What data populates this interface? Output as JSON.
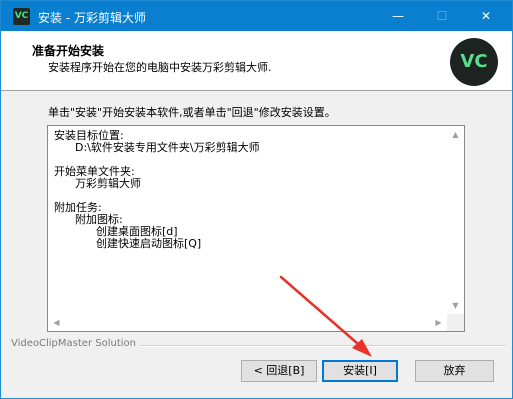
{
  "window": {
    "title": "安装 - 万彩剪辑大师",
    "app_icon_text": "VC",
    "controls": {
      "minimize": "—",
      "maximize": "☐",
      "close": "✕"
    }
  },
  "header": {
    "title": "准备开始安装",
    "subtitle": "安装程序开始在您的电脑中安装万彩剪辑大师.",
    "logo_text": "VC"
  },
  "instruction": "单击\"安装\"开始安装本软件,或者单击\"回退\"修改安装设置。",
  "summary": {
    "lines": [
      "安装目标位置:",
      "      D:\\软件安装专用文件夹\\万彩剪辑大师",
      "",
      "开始菜单文件夹:",
      "      万彩剪辑大师",
      "",
      "附加任务:",
      "      附加图标:",
      "            创建桌面图标[d]",
      "            创建快速启动图标[Q]"
    ]
  },
  "brand": "VideoClipMaster Solution",
  "buttons": {
    "back": "< 回退[B]",
    "install": "安装[I]",
    "cancel": "放弃"
  },
  "annotation_color": "#e8322b"
}
